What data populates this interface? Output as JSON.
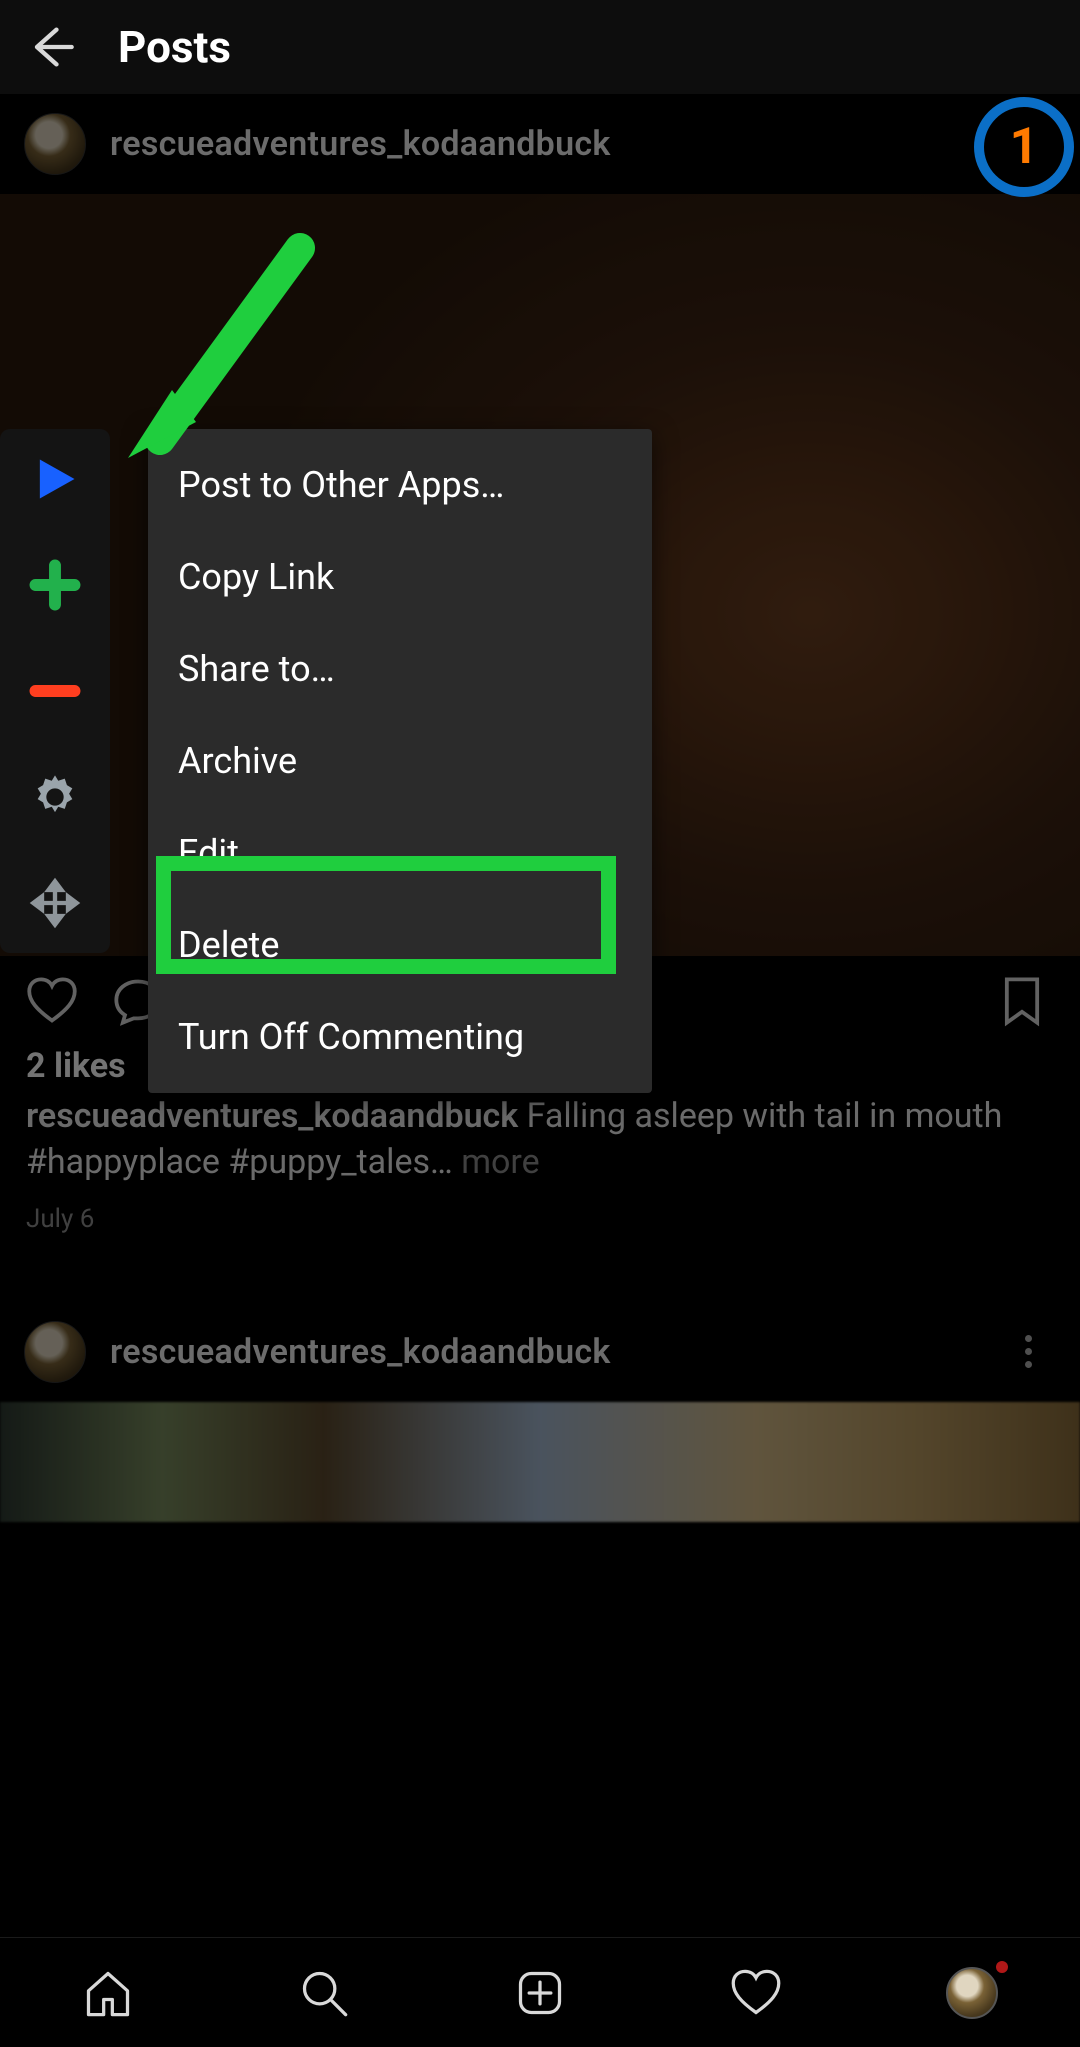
{
  "header": {
    "title": "Posts"
  },
  "post1": {
    "username": "rescueadventures_kodaandbuck",
    "likes": "2 likes",
    "caption_username": "rescueadventures_kodaandbuck",
    "caption_text": " Falling asleep with tail in mouth #happyplace #puppy_tales… ",
    "more": "more",
    "timestamp": "July 6"
  },
  "post2": {
    "username": "rescueadventures_kodaandbuck"
  },
  "menu": {
    "items": [
      "Post to Other Apps…",
      "Copy Link",
      "Share to…",
      "Archive",
      "Edit",
      "Delete",
      "Turn Off Commenting"
    ]
  },
  "annotations": {
    "step_number": "1",
    "highlighted_menu_item": "Delete"
  },
  "colors": {
    "highlight_green": "#1fce3e",
    "badge_border": "#0b6fc7",
    "badge_text": "#ff7a00"
  }
}
